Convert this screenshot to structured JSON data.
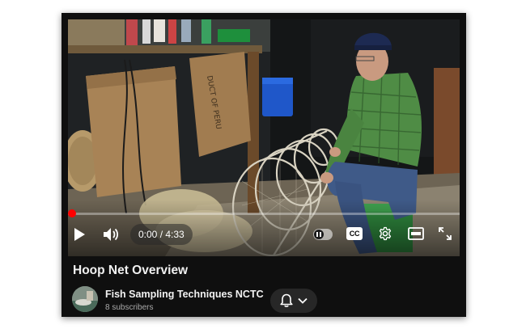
{
  "player": {
    "current_time": "0:00",
    "duration": "4:33",
    "time_separator": " / ",
    "progress_fraction": 0.0,
    "cc_label": "CC",
    "accent_color": "#ff0000"
  },
  "video": {
    "title": "Hoop Net Overview"
  },
  "channel": {
    "name": "Fish Sampling Techniques NCTC",
    "subscribers": "8 subscribers"
  },
  "icons": {
    "play": "play-icon",
    "volume": "volume-icon",
    "autoplay": "autoplay-toggle",
    "captions": "captions-icon",
    "settings": "gear-icon",
    "theater": "theater-mode-icon",
    "fullscreen": "fullscreen-icon",
    "bell": "bell-icon",
    "chevron": "chevron-down-icon"
  }
}
